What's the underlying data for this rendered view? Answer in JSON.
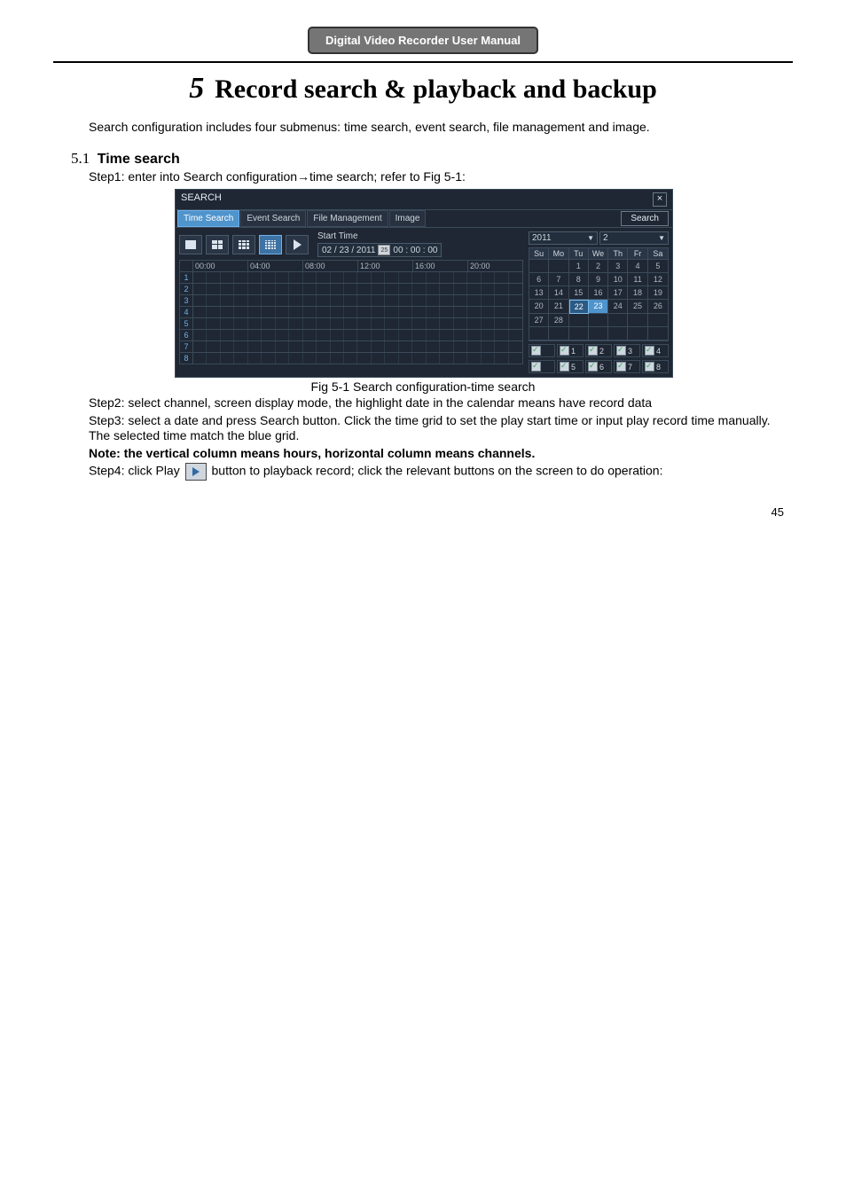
{
  "doc_bar": "Digital Video Recorder User Manual",
  "chapter": {
    "num": "5",
    "title": "Record search & playback and backup"
  },
  "intro": "Search configuration includes four submenus: time search, event search, file management and image.",
  "section": {
    "num": "5.1",
    "title": "Time search"
  },
  "steps": {
    "s1_prefix": "Step1: enter into Search configuration",
    "s1_arrow": "→",
    "s1_suffix": "time search; refer to Fig 5-1:",
    "s2": "Step2: select channel, screen display mode, the highlight date in the calendar means have record data",
    "s3": "Step3: select a date and press Search button. Click the time grid to set the play start time or input play record time manually. The selected time match the blue grid.",
    "note": "Note: the vertical column means hours, horizontal column means channels.",
    "s4a": "Step4: click Play ",
    "s4b": " button to playback record; click the relevant buttons on the screen to do operation:"
  },
  "fig_caption": "Fig 5-1 Search configuration-time search",
  "page_number": "45",
  "dlg": {
    "title": "SEARCH",
    "close": "×",
    "tabs": [
      "Time Search",
      "Event Search",
      "File Management",
      "Image"
    ],
    "search_btn": "Search",
    "start_time_label": "Start Time",
    "start_time_date": "02 / 23 / 2011",
    "start_time_day": "25",
    "start_time_time": "00 : 00 : 00",
    "timeline_hours": [
      "00:00",
      "04:00",
      "08:00",
      "12:00",
      "16:00",
      "20:00"
    ],
    "timeline_rows": [
      "1",
      "2",
      "3",
      "4",
      "5",
      "6",
      "7",
      "8"
    ],
    "year": "2011",
    "month": "2",
    "weekdays": [
      "Su",
      "Mo",
      "Tu",
      "We",
      "Th",
      "Fr",
      "Sa"
    ],
    "cal": [
      [
        "",
        "",
        "1",
        "2",
        "3",
        "4",
        "5"
      ],
      [
        "6",
        "7",
        "8",
        "9",
        "10",
        "11",
        "12"
      ],
      [
        "13",
        "14",
        "15",
        "16",
        "17",
        "18",
        "19"
      ],
      [
        "20",
        "21",
        "22",
        "23",
        "24",
        "25",
        "26"
      ],
      [
        "27",
        "28",
        "",
        "",
        "",
        "",
        ""
      ],
      [
        "",
        "",
        "",
        "",
        "",
        "",
        ""
      ]
    ],
    "cal_selected": "22",
    "cal_highlight": "23",
    "channels_row1": [
      "",
      "1",
      "2",
      "3",
      "4"
    ],
    "channels_row2": [
      "",
      "5",
      "6",
      "7",
      "8"
    ]
  }
}
